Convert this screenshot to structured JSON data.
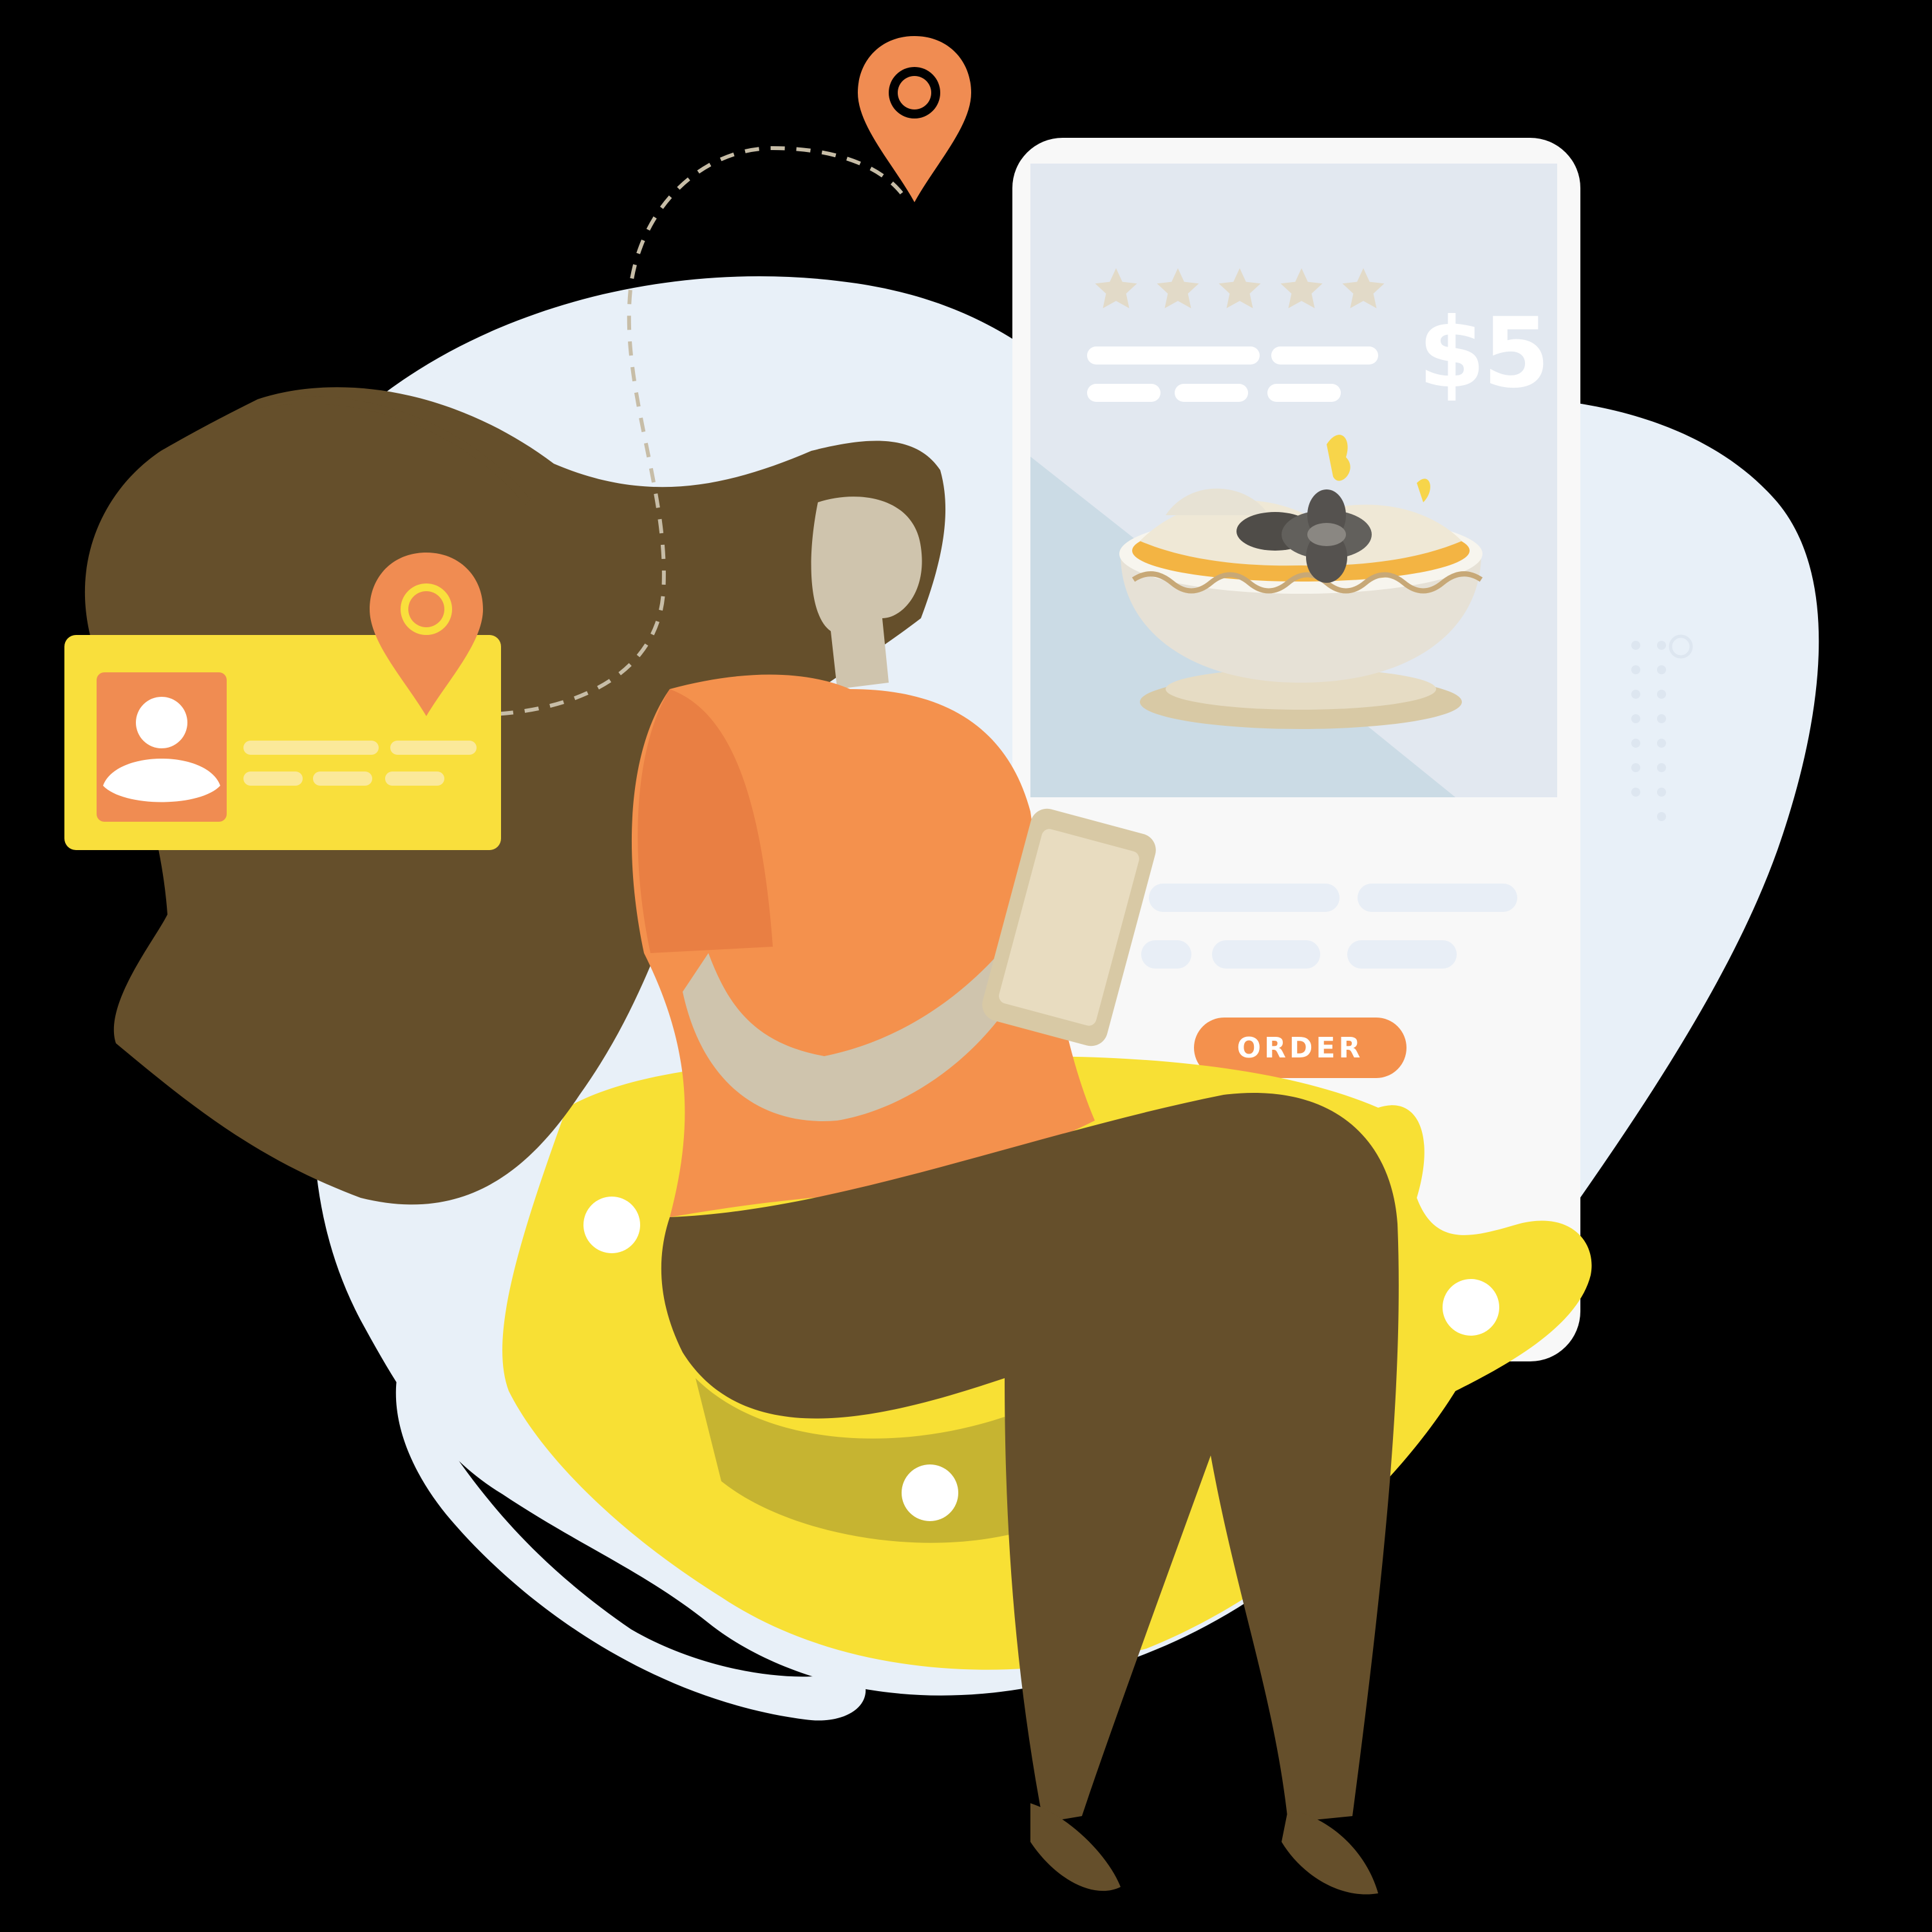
{
  "illustration": {
    "price_label": "$5",
    "order_button_label": "ORDER",
    "rating_stars": 5
  },
  "colors": {
    "background": "#000000",
    "blob": "#e8f0f8",
    "accent_orange": "#f4914d",
    "card_yellow": "#f9df3c",
    "seat_yellow": "#f8e034",
    "hair_brown": "#654f2b",
    "skin": "#cfc4ad"
  },
  "icons": [
    "location-pin-icon",
    "user-profile-icon",
    "star-icon",
    "food-bowl-icon"
  ]
}
